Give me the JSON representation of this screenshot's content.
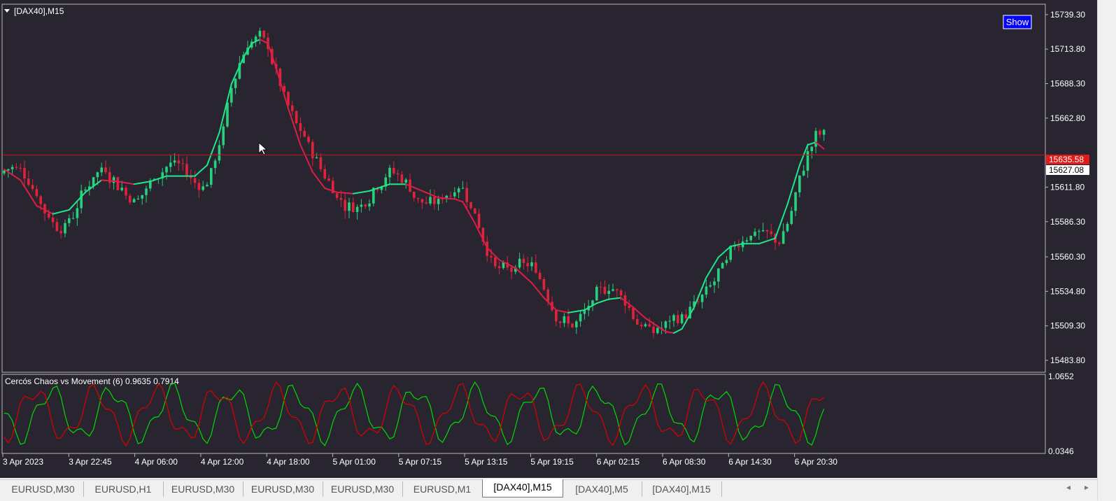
{
  "chart_data": [
    {
      "type": "candlestick",
      "title": "[DAX40],M15",
      "ylim": [
        15475,
        15747
      ],
      "yticks": [
        "15739.30",
        "15713.80",
        "15688.30",
        "15662.80",
        "15611.80",
        "15586.30",
        "15560.30",
        "15534.80",
        "15509.30",
        "15483.80"
      ],
      "xticks": [
        "3 Apr 2023",
        "3 Apr 22:45",
        "4 Apr 06:00",
        "4 Apr 12:00",
        "4 Apr 18:00",
        "5 Apr 01:00",
        "5 Apr 07:15",
        "5 Apr 13:15",
        "5 Apr 19:15",
        "6 Apr 02:15",
        "6 Apr 08:30",
        "6 Apr 14:30",
        "6 Apr 20:30"
      ],
      "bid_price": "15635.58",
      "current_price": "15627.08",
      "trend_line": {
        "name": "moving average",
        "points": [
          [
            0,
            15625
          ],
          [
            4,
            15617
          ],
          [
            8,
            15598
          ],
          [
            12,
            15592
          ],
          [
            16,
            15595
          ],
          [
            20,
            15608
          ],
          [
            24,
            15617
          ],
          [
            28,
            15616
          ],
          [
            32,
            15614
          ],
          [
            36,
            15616
          ],
          [
            40,
            15620
          ],
          [
            44,
            15620
          ],
          [
            47,
            15620
          ],
          [
            50,
            15628
          ],
          [
            53,
            15652
          ],
          [
            56,
            15688
          ],
          [
            59,
            15708
          ],
          [
            61,
            15718
          ],
          [
            63,
            15721
          ],
          [
            65,
            15718
          ],
          [
            67,
            15700
          ],
          [
            70,
            15670
          ],
          [
            73,
            15643
          ],
          [
            76,
            15623
          ],
          [
            79,
            15611
          ],
          [
            82,
            15608
          ],
          [
            86,
            15607
          ],
          [
            90,
            15609
          ],
          [
            93,
            15612
          ],
          [
            95,
            15614
          ],
          [
            99,
            15614
          ],
          [
            103,
            15609
          ],
          [
            107,
            15604
          ],
          [
            111,
            15603
          ],
          [
            113,
            15601
          ],
          [
            116,
            15585
          ],
          [
            119,
            15567
          ],
          [
            122,
            15558
          ],
          [
            126,
            15552
          ],
          [
            130,
            15541
          ],
          [
            133,
            15530
          ],
          [
            136,
            15521
          ],
          [
            139,
            15519
          ],
          [
            143,
            15521
          ],
          [
            146,
            15526
          ],
          [
            149,
            15529
          ],
          [
            152,
            15530
          ],
          [
            155,
            15523
          ],
          [
            158,
            15515
          ],
          [
            161,
            15509
          ],
          [
            163,
            15505
          ],
          [
            165,
            15504
          ],
          [
            167,
            15507
          ],
          [
            170,
            15523
          ],
          [
            173,
            15545
          ],
          [
            176,
            15560
          ],
          [
            179,
            15568
          ],
          [
            182,
            15570
          ],
          [
            186,
            15570
          ],
          [
            190,
            15574
          ],
          [
            193,
            15599
          ],
          [
            196,
            15628
          ],
          [
            198,
            15643
          ],
          [
            200,
            15645
          ],
          [
            202,
            15640
          ]
        ]
      },
      "price_line": 15635.58
    },
    {
      "type": "line",
      "title": "Cercós Chaos vs Movement (6) 0.9635 0.7914",
      "ylim": [
        0.0346,
        1.0652
      ],
      "yticks": [
        "1.0652",
        "0.0346"
      ],
      "series": [
        {
          "color": "#00dc00"
        },
        {
          "color": "#dc0000"
        }
      ]
    }
  ],
  "ui": {
    "show_button": "Show",
    "tabs": [
      "EURUSD,M30",
      "EURUSD,H1",
      "EURUSD,M30",
      "EURUSD,M30",
      "EURUSD,M30",
      "EURUSD,M1",
      "[DAX40],M15",
      "[DAX40],M5",
      "[DAX40],M15"
    ],
    "active_tab": 6,
    "nav_left": "◄",
    "nav_right": "►"
  },
  "colors": {
    "background": "#282430",
    "bull": "#26d07c",
    "bear": "#e0223a",
    "ma_up": "#1ee68a",
    "ma_down": "#dc1e46",
    "price_line": "#c81414",
    "axis_text": "#ffffff"
  }
}
